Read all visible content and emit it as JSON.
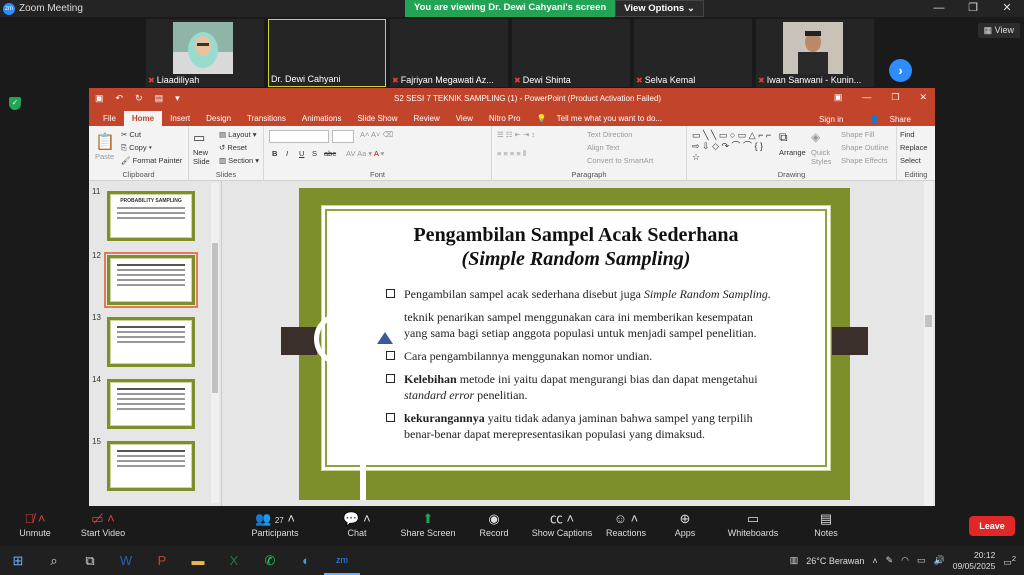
{
  "window": {
    "app_title": "Zoom Meeting"
  },
  "banner": {
    "message": "You are viewing Dr. Dewi Cahyani's screen",
    "options": "View Options"
  },
  "win_controls": {
    "minimize": "—",
    "restore": "❐",
    "close": "✕"
  },
  "participants": [
    {
      "name": "Liaadiliyah",
      "muted": true
    },
    {
      "name": "Dr. Dewi Cahyani",
      "muted": false
    },
    {
      "name": "Fajriyan Megawati Az...",
      "muted": true
    },
    {
      "name": "Dewi Shinta",
      "muted": true
    },
    {
      "name": "Selva Kemal",
      "muted": true
    },
    {
      "name": "Iwan Sanwani - Kunin...",
      "muted": true
    }
  ],
  "view_button": "View",
  "ppt": {
    "title": "S2 SESI 7 TEKNIK SAMPLING (1) - PowerPoint (Product Activation Failed)",
    "tabs": [
      "File",
      "Home",
      "Insert",
      "Design",
      "Transitions",
      "Animations",
      "Slide Show",
      "Review",
      "View",
      "Nitro Pro"
    ],
    "tell_me": "Tell me what you want to do...",
    "sign_in": "Sign in",
    "share": "Share",
    "ribbon": {
      "clipboard": {
        "paste": "Paste",
        "cut": "Cut",
        "copy": "Copy",
        "format_painter": "Format Painter",
        "label": "Clipboard"
      },
      "slides": {
        "new_slide": "New Slide",
        "layout": "Layout",
        "reset": "Reset",
        "section": "Section",
        "label": "Slides"
      },
      "font": {
        "label": "Font",
        "bold": "B",
        "italic": "I",
        "underline": "U",
        "shadow": "S",
        "strike": "abc"
      },
      "paragraph": {
        "text_direction": "Text Direction",
        "align_text": "Align Text",
        "smartart": "Convert to SmartArt",
        "label": "Paragraph"
      },
      "drawing": {
        "arrange": "Arrange",
        "quick_styles": "Quick Styles",
        "shape_fill": "Shape Fill",
        "shape_outline": "Shape Outline",
        "shape_effects": "Shape Effects",
        "label": "Drawing"
      },
      "editing": {
        "find": "Find",
        "replace": "Replace",
        "select": "Select",
        "label": "Editing"
      }
    },
    "thumb_numbers": [
      "11",
      "12",
      "13",
      "14",
      "15"
    ],
    "thumb11_title": "PROBABILITY SAMPLING",
    "slide": {
      "title": "Pengambilan Sampel Acak Sederhana",
      "subtitle": "(Simple Random Sampling)",
      "b1_text": "Pengambilan sampel acak sederhana disebut juga ",
      "b1_italic": "Simple Random Sampling.",
      "b2_text": "teknik penarikan sampel menggunakan cara ini memberikan kesempatan yang sama bagi setiap anggota populasi untuk menjadi sampel penelitian.",
      "b3_text": "Cara pengambilannya menggunakan nomor undian.",
      "b4_bold": "Kelebihan",
      "b4_text": " metode ini yaitu dapat mengurangi bias dan       dapat mengetahui ",
      "b4_italic": "standard error",
      "b4_tail": " penelitian.",
      "b5_bold": "kekurangannya",
      "b5_text": " yaitu tidak adanya jaminan bahwa sampel yang terpilih benar-benar dapat merepresentasikan populasi yang dimaksud."
    }
  },
  "toolbar": {
    "unmute": "Unmute",
    "start_video": "Start Video",
    "participants": "Participants",
    "participants_count": "27",
    "chat": "Chat",
    "share_screen": "Share Screen",
    "record": "Record",
    "captions": "Show Captions",
    "reactions": "Reactions",
    "apps": "Apps",
    "whiteboards": "Whiteboards",
    "notes": "Notes",
    "leave": "Leave"
  },
  "taskbar": {
    "weather": "26°C  Berawan",
    "time": "20:12",
    "date": "09/05/2025",
    "notif_count": "2"
  }
}
